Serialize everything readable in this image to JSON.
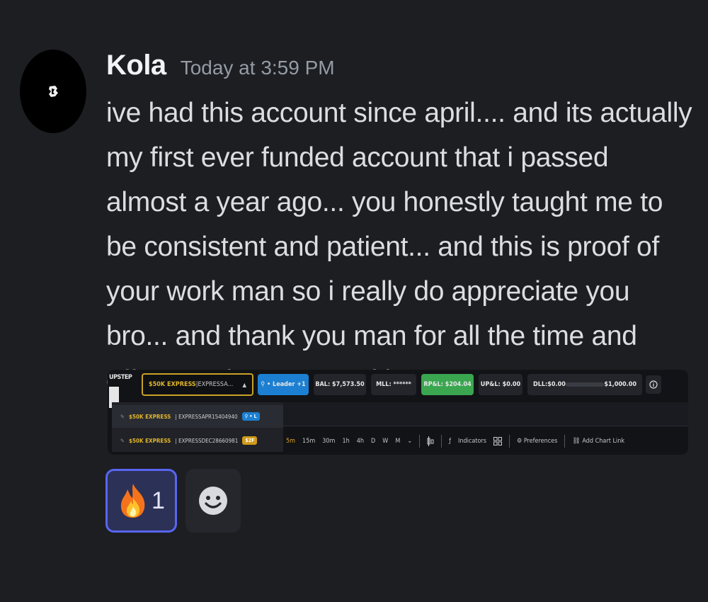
{
  "message": {
    "author": "Kola",
    "timestamp": "Today at 3:59 PM",
    "text": "ive had this account since april.... and its actually my first ever funded account that i passed almost a year ago... you honestly taught me to be consistent and patient... and this is proof of your work man so i really do appreciate you bro... and thank you man for all the time and effort you have poured into us"
  },
  "embed": {
    "logo_text": "UPSTEP",
    "account_select": {
      "tier": "$50K EXPRESS",
      "sep": " | ",
      "name": "EXPRESSA...",
      "caret": "▲"
    },
    "leader_label": "⚲ • Leader +1",
    "bal_label": "BAL: $7,573.50",
    "mll_label": "MLL: ******",
    "rpl_label": "RP&L: $204.04",
    "upl_label": "UP&L: $0.00",
    "dll_label": "DLL:$0.00",
    "dll_value": "$1,000.00",
    "dropdown": [
      {
        "tier": "$50K EXPRESS",
        "name": " | EXPRESSAPR15404940",
        "tag": "⚲ • L"
      },
      {
        "tier": "$50K EXPRESS",
        "name": " | EXPRESSDEC28660981",
        "tag": "$2F"
      }
    ],
    "toolbar": {
      "timeframes": [
        "5m",
        "15m",
        "30m",
        "1h",
        "4h",
        "D",
        "W",
        "M"
      ],
      "indicators_label": "Indicators",
      "preferences_label": "Preferences",
      "add_chart_label": "Add Chart Link"
    }
  },
  "reactions": [
    {
      "emoji": "🔥",
      "count": "1"
    }
  ],
  "colors": {
    "background": "#1d1e22",
    "reaction_active_bg": "#2c3157",
    "reaction_active_border": "#5865f2",
    "account_gold": "#e0b52b",
    "leader_blue": "#1c7fd1",
    "rpl_green": "#3aa650"
  },
  "icons": {
    "avatar": "abstract-white-glyph",
    "add_reaction": "smiley-face-icon"
  }
}
